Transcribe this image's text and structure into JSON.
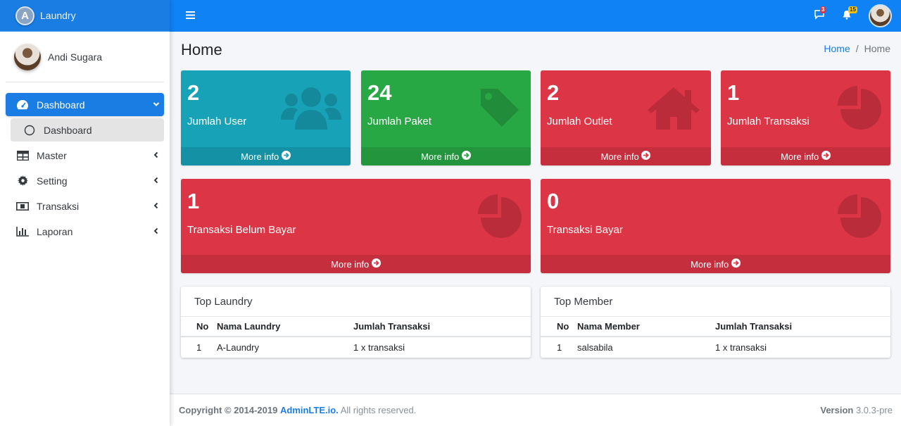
{
  "brand": {
    "logo_letter": "A",
    "name": "Laundry"
  },
  "user": {
    "name": "Andi Sugara"
  },
  "sidebar": {
    "items": [
      {
        "label": "Dashboard",
        "icon": "tachometer-icon",
        "arrow": "⌄",
        "active": true
      },
      {
        "label": "Dashboard",
        "icon": "circle-icon",
        "sub": true
      },
      {
        "label": "Master",
        "icon": "table-icon",
        "arrow": "‹"
      },
      {
        "label": "Setting",
        "icon": "gear-icon",
        "arrow": "‹"
      },
      {
        "label": "Transaksi",
        "icon": "money-icon",
        "arrow": "‹"
      },
      {
        "label": "Laporan",
        "icon": "bar-chart-icon",
        "arrow": "‹"
      }
    ]
  },
  "navbar": {
    "messages_badge": "3",
    "notifications_badge": "15"
  },
  "page": {
    "title": "Home",
    "breadcrumb": {
      "home": "Home",
      "current": "Home"
    }
  },
  "stats": [
    {
      "value": "2",
      "label": "Jumlah User",
      "more": "More info",
      "color": "#17a2b8",
      "icon": "users-icon"
    },
    {
      "value": "24",
      "label": "Jumlah Paket",
      "more": "More info",
      "color": "#28a745",
      "icon": "tag-icon"
    },
    {
      "value": "2",
      "label": "Jumlah Outlet",
      "more": "More info",
      "color": "#dc3545",
      "icon": "home-icon"
    },
    {
      "value": "1",
      "label": "Jumlah Transaksi",
      "more": "More info",
      "color": "#dc3545",
      "icon": "pie-chart-icon"
    },
    {
      "value": "1",
      "label": "Transaksi Belum Bayar",
      "more": "More info",
      "color": "#dc3545",
      "icon": "pie-chart-icon"
    },
    {
      "value": "0",
      "label": "Transaksi Bayar",
      "more": "More info",
      "color": "#dc3545",
      "icon": "pie-chart-icon"
    }
  ],
  "top_laundry": {
    "title": "Top Laundry",
    "columns": [
      "No",
      "Nama Laundry",
      "Jumlah Transaksi"
    ],
    "rows": [
      [
        "1",
        "A-Laundry",
        "1 x transaksi"
      ]
    ]
  },
  "top_member": {
    "title": "Top Member",
    "columns": [
      "No",
      "Nama Member",
      "Jumlah Transaksi"
    ],
    "rows": [
      [
        "1",
        "salsabila",
        "1 x transaksi"
      ]
    ]
  },
  "footer": {
    "copyright": "Copyright © 2014-2019",
    "link": "AdminLTE.io.",
    "rights": "All rights reserved.",
    "version_label": "Version",
    "version": "3.0.3-pre"
  }
}
